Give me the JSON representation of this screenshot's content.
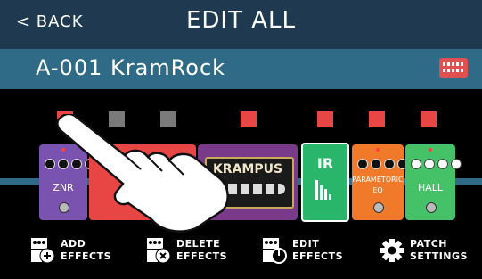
{
  "header": {
    "back_label": "< BACK",
    "title": "EDIT ALL"
  },
  "patch": {
    "name": "A-001 KramRock",
    "keyboard_icon": "keyboard-icon"
  },
  "slots": [
    {
      "color": "#e84545",
      "on": true
    },
    {
      "color": "#7a7a7a",
      "on": false
    },
    {
      "color": "#7a7a7a",
      "on": false
    },
    {
      "color": "#e84545",
      "on": true
    },
    {
      "color": "#e84545",
      "on": true
    },
    {
      "color": "#e84545",
      "on": true
    },
    {
      "color": "#e84545",
      "on": true
    }
  ],
  "effects": [
    {
      "name": "ZNR",
      "color": "#7a52b0"
    },
    {
      "name": "",
      "color": "#e84545"
    },
    {
      "name": "KRAMPUS",
      "color": "#7a3a8a"
    },
    {
      "name": "IR",
      "color": "#29b66a"
    },
    {
      "name": "PARAMETORIC EQ",
      "color": "#f07a2a"
    },
    {
      "name": "HALL",
      "color": "#45c268"
    }
  ],
  "toolbar": {
    "add_line1": "ADD",
    "add_line2": "EFFECTS",
    "delete_line1": "DELETE",
    "delete_line2": "EFFECTS",
    "edit_line1": "EDIT",
    "edit_line2": "EFFECTS",
    "patch_line1": "PATCH",
    "patch_line2": "SETTINGS"
  }
}
